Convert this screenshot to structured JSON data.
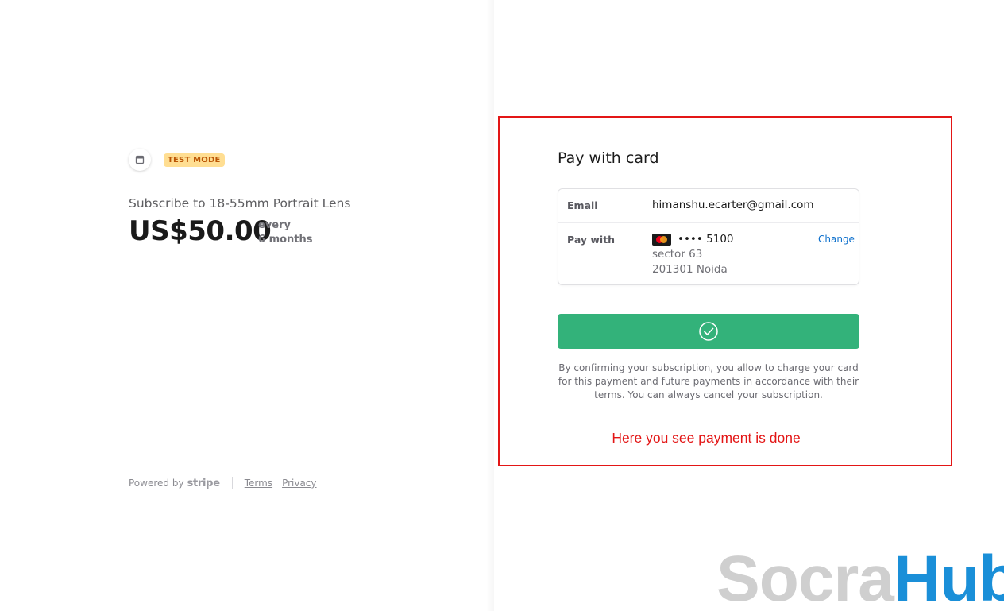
{
  "merchant": {
    "icon": "store-icon",
    "test_badge": "TEST MODE"
  },
  "product": {
    "name": "Subscribe to 18-55mm Portrait Lens",
    "price": "US$50.00",
    "period_line1": "every",
    "period_line2": "6 months"
  },
  "footer": {
    "powered_by": "Powered by",
    "brand": "stripe",
    "terms": "Terms",
    "privacy": "Privacy"
  },
  "payment": {
    "title": "Pay with card",
    "email_label": "Email",
    "email_value": "himanshu.ecarter@gmail.com",
    "pay_with_label": "Pay with",
    "card_brand_icon": "mastercard-icon",
    "card_masked": "•••• 5100",
    "address_line1": "sector 63",
    "address_line2": "201301 Noida",
    "change_label": "Change",
    "confirm_icon": "check-circle-icon",
    "legal_text": "By confirming your subscription, you allow to charge your card for this payment and future payments in accordance with their terms. You can always cancel your subscription."
  },
  "annotation": {
    "text": "Here you see payment is done",
    "color": "#e31616"
  },
  "watermark": {
    "part1": "Socra",
    "part2": "Hub"
  },
  "colors": {
    "confirm_button": "#33b27a",
    "link": "#0a6ecc",
    "test_badge_bg": "#ffde92",
    "test_badge_text": "#bb5504"
  }
}
